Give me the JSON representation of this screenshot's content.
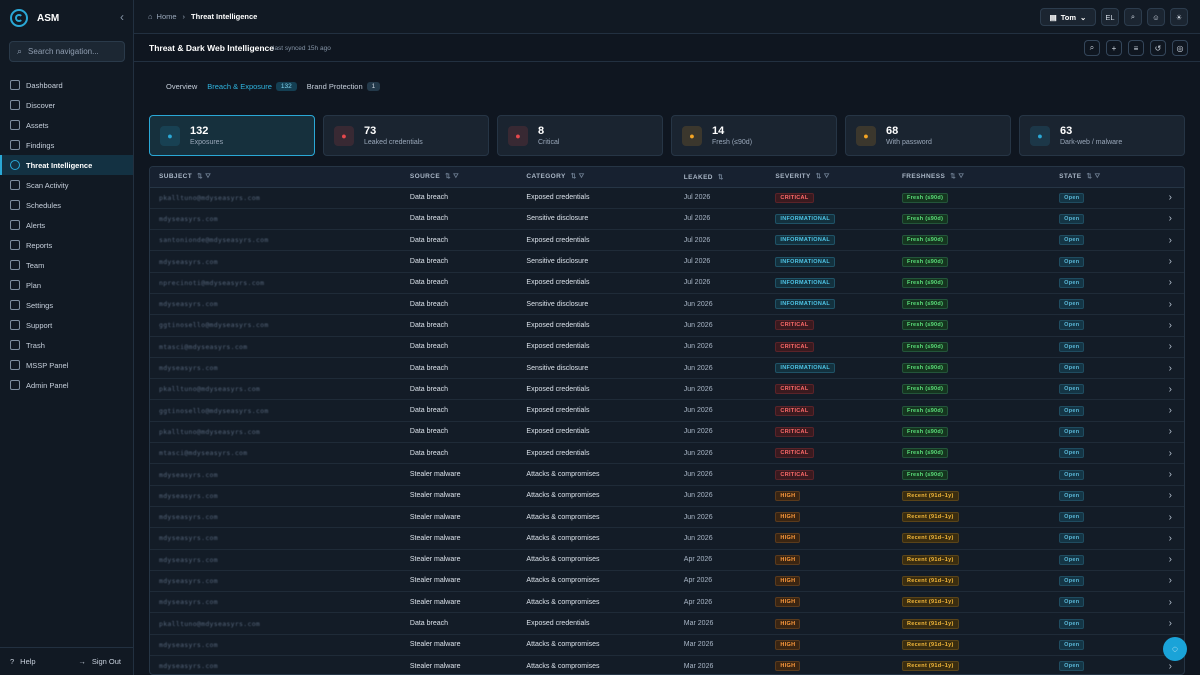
{
  "app": {
    "name": "ASM",
    "collapse_icon": "‹"
  },
  "sidebar": {
    "search_placeholder": "Search navigation...",
    "items": [
      {
        "label": "Dashboard",
        "icon": "dashboard-icon"
      },
      {
        "label": "Discover",
        "icon": "discover-icon"
      },
      {
        "label": "Assets",
        "icon": "assets-icon"
      },
      {
        "label": "Findings",
        "icon": "findings-icon"
      },
      {
        "label": "Threat Intelligence",
        "icon": "threat-icon",
        "active": true
      },
      {
        "label": "Scan Activity",
        "icon": "activity-icon"
      },
      {
        "label": "Schedules",
        "icon": "schedules-icon"
      },
      {
        "label": "Alerts",
        "icon": "alerts-icon"
      },
      {
        "label": "Reports",
        "icon": "reports-icon"
      },
      {
        "label": "Team",
        "icon": "team-icon"
      },
      {
        "label": "Plan",
        "icon": "plan-icon"
      },
      {
        "label": "Settings",
        "icon": "settings-icon"
      },
      {
        "label": "Support",
        "icon": "support-icon"
      },
      {
        "label": "Trash",
        "icon": "trash-icon"
      },
      {
        "label": "MSSP Panel",
        "icon": "mssp-icon"
      },
      {
        "label": "Admin Panel",
        "icon": "admin-icon"
      }
    ],
    "help_label": "Help",
    "signout_label": "Sign Out"
  },
  "topbar": {
    "breadcrumb_home": "Home",
    "breadcrumb_current": "Threat Intelligence",
    "user_name": "Tom",
    "user_initials": "EL"
  },
  "page": {
    "title": "Threat & Dark Web Intelligence",
    "subtitle": "last synced 15h ago"
  },
  "tabs": [
    {
      "label": "Overview",
      "count": null
    },
    {
      "label": "Breach & Exposure",
      "count": "132",
      "active": true
    },
    {
      "label": "Brand Protection",
      "count": "1"
    }
  ],
  "stats": [
    {
      "value": "132",
      "label": "Exposures",
      "icon": "shield-icon",
      "color": "#2aa8d6",
      "active": true
    },
    {
      "value": "73",
      "label": "Leaked credentials",
      "icon": "key-icon",
      "color": "#e5484d"
    },
    {
      "value": "8",
      "label": "Critical",
      "icon": "flame-icon",
      "color": "#e5484d"
    },
    {
      "value": "14",
      "label": "Fresh (≤90d)",
      "icon": "sparkle-icon",
      "color": "#f5a524"
    },
    {
      "value": "68",
      "label": "With password",
      "icon": "lock-icon",
      "color": "#f5a524"
    },
    {
      "value": "63",
      "label": "Dark-web / malware",
      "icon": "eye-icon",
      "color": "#2aa8d6"
    }
  ],
  "table": {
    "columns": [
      "SUBJECT",
      "SOURCE",
      "CATEGORY",
      "LEAKED",
      "SEVERITY",
      "FRESHNESS",
      "STATE"
    ],
    "rows": [
      {
        "subject": "pkalltuno@mdyseasyrs.com",
        "source": "Data breach",
        "category": "Exposed credentials",
        "leaked": "Jul 2026",
        "severity": "CRITICAL",
        "freshness": "Fresh (≤90d)",
        "state": "Open"
      },
      {
        "subject": "mdyseasyrs.com",
        "source": "Data breach",
        "category": "Sensitive disclosure",
        "leaked": "Jul 2026",
        "severity": "INFORMATIONAL",
        "freshness": "Fresh (≤90d)",
        "state": "Open"
      },
      {
        "subject": "santonionde@mdyseasyrs.com",
        "source": "Data breach",
        "category": "Exposed credentials",
        "leaked": "Jul 2026",
        "severity": "INFORMATIONAL",
        "freshness": "Fresh (≤90d)",
        "state": "Open"
      },
      {
        "subject": "mdyseasyrs.com",
        "source": "Data breach",
        "category": "Sensitive disclosure",
        "leaked": "Jul 2026",
        "severity": "INFORMATIONAL",
        "freshness": "Fresh (≤90d)",
        "state": "Open"
      },
      {
        "subject": "nprecinoti@mdyseasyrs.com",
        "source": "Data breach",
        "category": "Exposed credentials",
        "leaked": "Jul 2026",
        "severity": "INFORMATIONAL",
        "freshness": "Fresh (≤90d)",
        "state": "Open"
      },
      {
        "subject": "mdyseasyrs.com",
        "source": "Data breach",
        "category": "Sensitive disclosure",
        "leaked": "Jun 2026",
        "severity": "INFORMATIONAL",
        "freshness": "Fresh (≤90d)",
        "state": "Open"
      },
      {
        "subject": "ggtinosello@mdyseasyrs.com",
        "source": "Data breach",
        "category": "Exposed credentials",
        "leaked": "Jun 2026",
        "severity": "CRITICAL",
        "freshness": "Fresh (≤90d)",
        "state": "Open"
      },
      {
        "subject": "mtasci@mdyseasyrs.com",
        "source": "Data breach",
        "category": "Exposed credentials",
        "leaked": "Jun 2026",
        "severity": "CRITICAL",
        "freshness": "Fresh (≤90d)",
        "state": "Open"
      },
      {
        "subject": "mdyseasyrs.com",
        "source": "Data breach",
        "category": "Sensitive disclosure",
        "leaked": "Jun 2026",
        "severity": "INFORMATIONAL",
        "freshness": "Fresh (≤90d)",
        "state": "Open"
      },
      {
        "subject": "pkalltuno@mdyseasyrs.com",
        "source": "Data breach",
        "category": "Exposed credentials",
        "leaked": "Jun 2026",
        "severity": "CRITICAL",
        "freshness": "Fresh (≤90d)",
        "state": "Open"
      },
      {
        "subject": "ggtinosello@mdyseasyrs.com",
        "source": "Data breach",
        "category": "Exposed credentials",
        "leaked": "Jun 2026",
        "severity": "CRITICAL",
        "freshness": "Fresh (≤90d)",
        "state": "Open"
      },
      {
        "subject": "pkalltuno@mdyseasyrs.com",
        "source": "Data breach",
        "category": "Exposed credentials",
        "leaked": "Jun 2026",
        "severity": "CRITICAL",
        "freshness": "Fresh (≤90d)",
        "state": "Open"
      },
      {
        "subject": "mtasci@mdyseasyrs.com",
        "source": "Data breach",
        "category": "Exposed credentials",
        "leaked": "Jun 2026",
        "severity": "CRITICAL",
        "freshness": "Fresh (≤90d)",
        "state": "Open"
      },
      {
        "subject": "mdyseasyrs.com",
        "source": "Stealer malware",
        "category": "Attacks & compromises",
        "leaked": "Jun 2026",
        "severity": "CRITICAL",
        "freshness": "Fresh (≤90d)",
        "state": "Open"
      },
      {
        "subject": "mdyseasyrs.com",
        "source": "Stealer malware",
        "category": "Attacks & compromises",
        "leaked": "Jun 2026",
        "severity": "HIGH",
        "freshness": "Recent (91d–1y)",
        "state": "Open"
      },
      {
        "subject": "mdyseasyrs.com",
        "source": "Stealer malware",
        "category": "Attacks & compromises",
        "leaked": "Jun 2026",
        "severity": "HIGH",
        "freshness": "Recent (91d–1y)",
        "state": "Open"
      },
      {
        "subject": "mdyseasyrs.com",
        "source": "Stealer malware",
        "category": "Attacks & compromises",
        "leaked": "Jun 2026",
        "severity": "HIGH",
        "freshness": "Recent (91d–1y)",
        "state": "Open"
      },
      {
        "subject": "mdyseasyrs.com",
        "source": "Stealer malware",
        "category": "Attacks & compromises",
        "leaked": "Apr 2026",
        "severity": "HIGH",
        "freshness": "Recent (91d–1y)",
        "state": "Open"
      },
      {
        "subject": "mdyseasyrs.com",
        "source": "Stealer malware",
        "category": "Attacks & compromises",
        "leaked": "Apr 2026",
        "severity": "HIGH",
        "freshness": "Recent (91d–1y)",
        "state": "Open"
      },
      {
        "subject": "mdyseasyrs.com",
        "source": "Stealer malware",
        "category": "Attacks & compromises",
        "leaked": "Apr 2026",
        "severity": "HIGH",
        "freshness": "Recent (91d–1y)",
        "state": "Open"
      },
      {
        "subject": "pkalltuno@mdyseasyrs.com",
        "source": "Data breach",
        "category": "Exposed credentials",
        "leaked": "Mar 2026",
        "severity": "HIGH",
        "freshness": "Recent (91d–1y)",
        "state": "Open"
      },
      {
        "subject": "mdyseasyrs.com",
        "source": "Stealer malware",
        "category": "Attacks & compromises",
        "leaked": "Mar 2026",
        "severity": "HIGH",
        "freshness": "Recent (91d–1y)",
        "state": "Open"
      },
      {
        "subject": "mdyseasyrs.com",
        "source": "Stealer malware",
        "category": "Attacks & compromises",
        "leaked": "Mar 2026",
        "severity": "HIGH",
        "freshness": "Recent (91d–1y)",
        "state": "Open"
      }
    ]
  },
  "colors": {
    "accent": "#2aa8d6",
    "critical": "#ff6b6b",
    "high": "#ff9b3d",
    "fresh": "#5be07b",
    "recent": "#f5b93a"
  }
}
